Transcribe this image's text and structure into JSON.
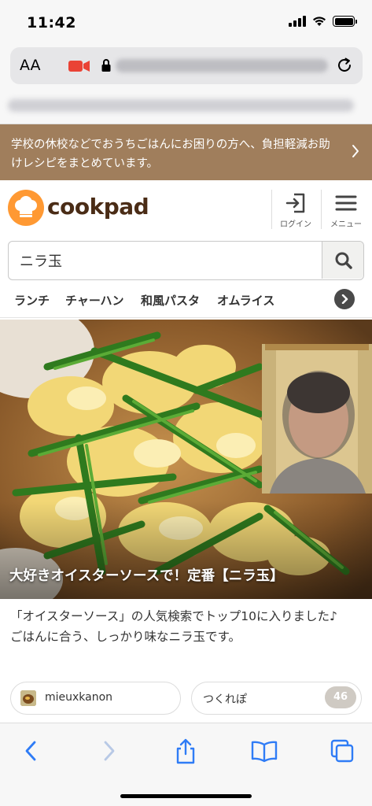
{
  "status_bar": {
    "time": "11:42"
  },
  "browser": {
    "aa_label": "AA"
  },
  "banner": {
    "text": "学校の休校などでおうちごはんにお困りの方へ、負担軽減お助けレシピをまとめています。"
  },
  "header": {
    "logo_text": "cookpad",
    "login_label": "ログイン",
    "menu_label": "メニュー"
  },
  "search": {
    "value": "ニラ玉"
  },
  "keywords": [
    "ランチ",
    "チャーハン",
    "和風パスタ",
    "オムライス"
  ],
  "recipe": {
    "title": "大好きオイスターソースで！定番【ニラ玉】",
    "description_line1": "「オイスターソース」の人気検索でトップ10に入りました♪",
    "description_line2": "ごはんに合う、しっかり味なニラ玉です。",
    "author": "mieuxkanon",
    "tsukurepo_label": "つくれぽ",
    "tsukurepo_count": "46"
  },
  "colors": {
    "banner": "#a07e5c",
    "logo": "#ff9933",
    "safari_blue": "#2f7cf6",
    "recording_red": "#ea4335"
  }
}
